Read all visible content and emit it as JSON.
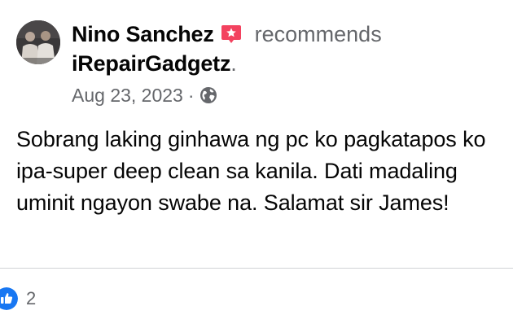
{
  "post": {
    "author": "Nino Sanchez",
    "action": "recommends",
    "page": "iRepairGadgetz",
    "page_suffix": ".",
    "date": "Aug 23, 2023",
    "separator": "·",
    "privacy_icon": "globe-icon",
    "recommend_icon": "star-recommend-icon",
    "text": "Sobrang laking ginhawa ng pc ko pagkatapos ko ipa-super deep clean sa kanila. Dati madaling uminit ngayon swabe na. Salamat sir James!"
  },
  "reactions": {
    "icon": "like-icon",
    "count": "2"
  },
  "colors": {
    "recommend_badge": "#f3425f",
    "like_blue": "#1877f2",
    "secondary_text": "#65676b",
    "divider": "#d0d2d6"
  }
}
